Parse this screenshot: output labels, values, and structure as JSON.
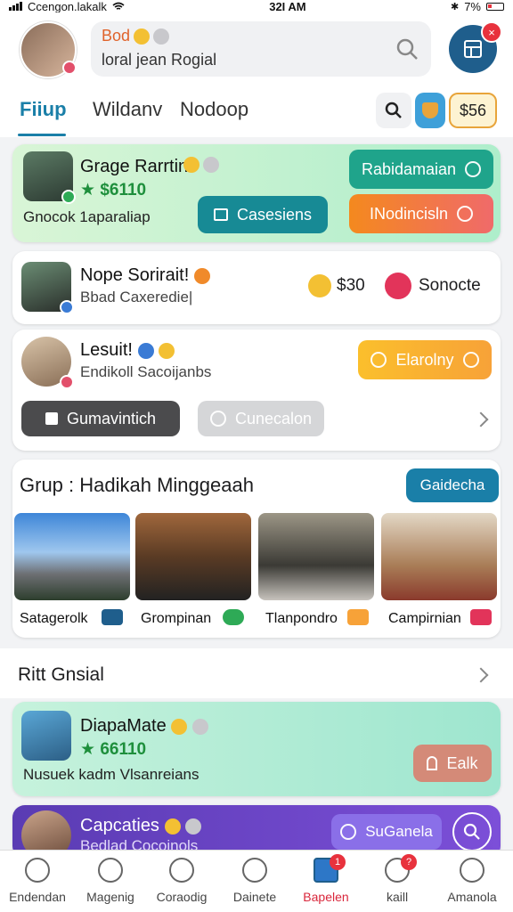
{
  "status_bar": {
    "carrier": "Ccengon.lakalk",
    "time": "32I AM",
    "battery": "7%"
  },
  "header": {
    "search_line1": "Bod",
    "search_line2": "loral jean Rogial",
    "badge": "×"
  },
  "tabs": [
    {
      "label": "Fiiup",
      "active": true
    },
    {
      "label": "Wildanv",
      "active": false
    },
    {
      "label": "Nodoop",
      "active": false
    }
  ],
  "tools": {
    "price": "$56"
  },
  "cards": {
    "c1": {
      "name": "Grage Rarrtin",
      "score": "$6110",
      "sub": "Gnocok 1aparaliap",
      "btn_top": "Rabidamaian",
      "btn_mid": "Casesiens",
      "btn_bottom": "INodincisln"
    },
    "c2": {
      "name": "Nope Sorirait!",
      "sub": "Bbad Caxeredie|",
      "price": "$30",
      "action": "Sonocte"
    },
    "c3": {
      "name": "Lesuit!",
      "sub": "Endikoll Sacoijanbs",
      "btn_right": "Elarolny",
      "btn_dark": "Gumavintich",
      "btn_grey": "Cunecalon"
    }
  },
  "group": {
    "title": "Grup :  Hadikah Minggeaah",
    "cta": "Gaidecha",
    "photos": [
      {
        "caption": "Satagerolk"
      },
      {
        "caption": "Grompinan"
      },
      {
        "caption": "Tlanpondro"
      },
      {
        "caption": "Campirnian"
      }
    ]
  },
  "section2": {
    "title": "Ritt Gnsial"
  },
  "cards2": {
    "c4": {
      "name": "DiapaMate",
      "score": "66110",
      "sub": "Nusuek  kadm Vlsanreians",
      "btn": "Ealk"
    },
    "c5": {
      "name": "Capcaties",
      "sub": "Bedlad Cocoinols",
      "btn": "SuGanela"
    }
  },
  "navbar": [
    {
      "label": "Endendan",
      "icon": "home-icon"
    },
    {
      "label": "Magenig",
      "icon": "heart-icon"
    },
    {
      "label": "Coraodig",
      "icon": "person-icon"
    },
    {
      "label": "Dainete",
      "icon": "plus-circle-icon"
    },
    {
      "label": "Bapelen",
      "icon": "house-icon",
      "active": true,
      "badge": "1"
    },
    {
      "label": "kaill",
      "icon": "profile-icon",
      "badge": "?"
    },
    {
      "label": "Amanola",
      "icon": "globe-icon"
    }
  ]
}
